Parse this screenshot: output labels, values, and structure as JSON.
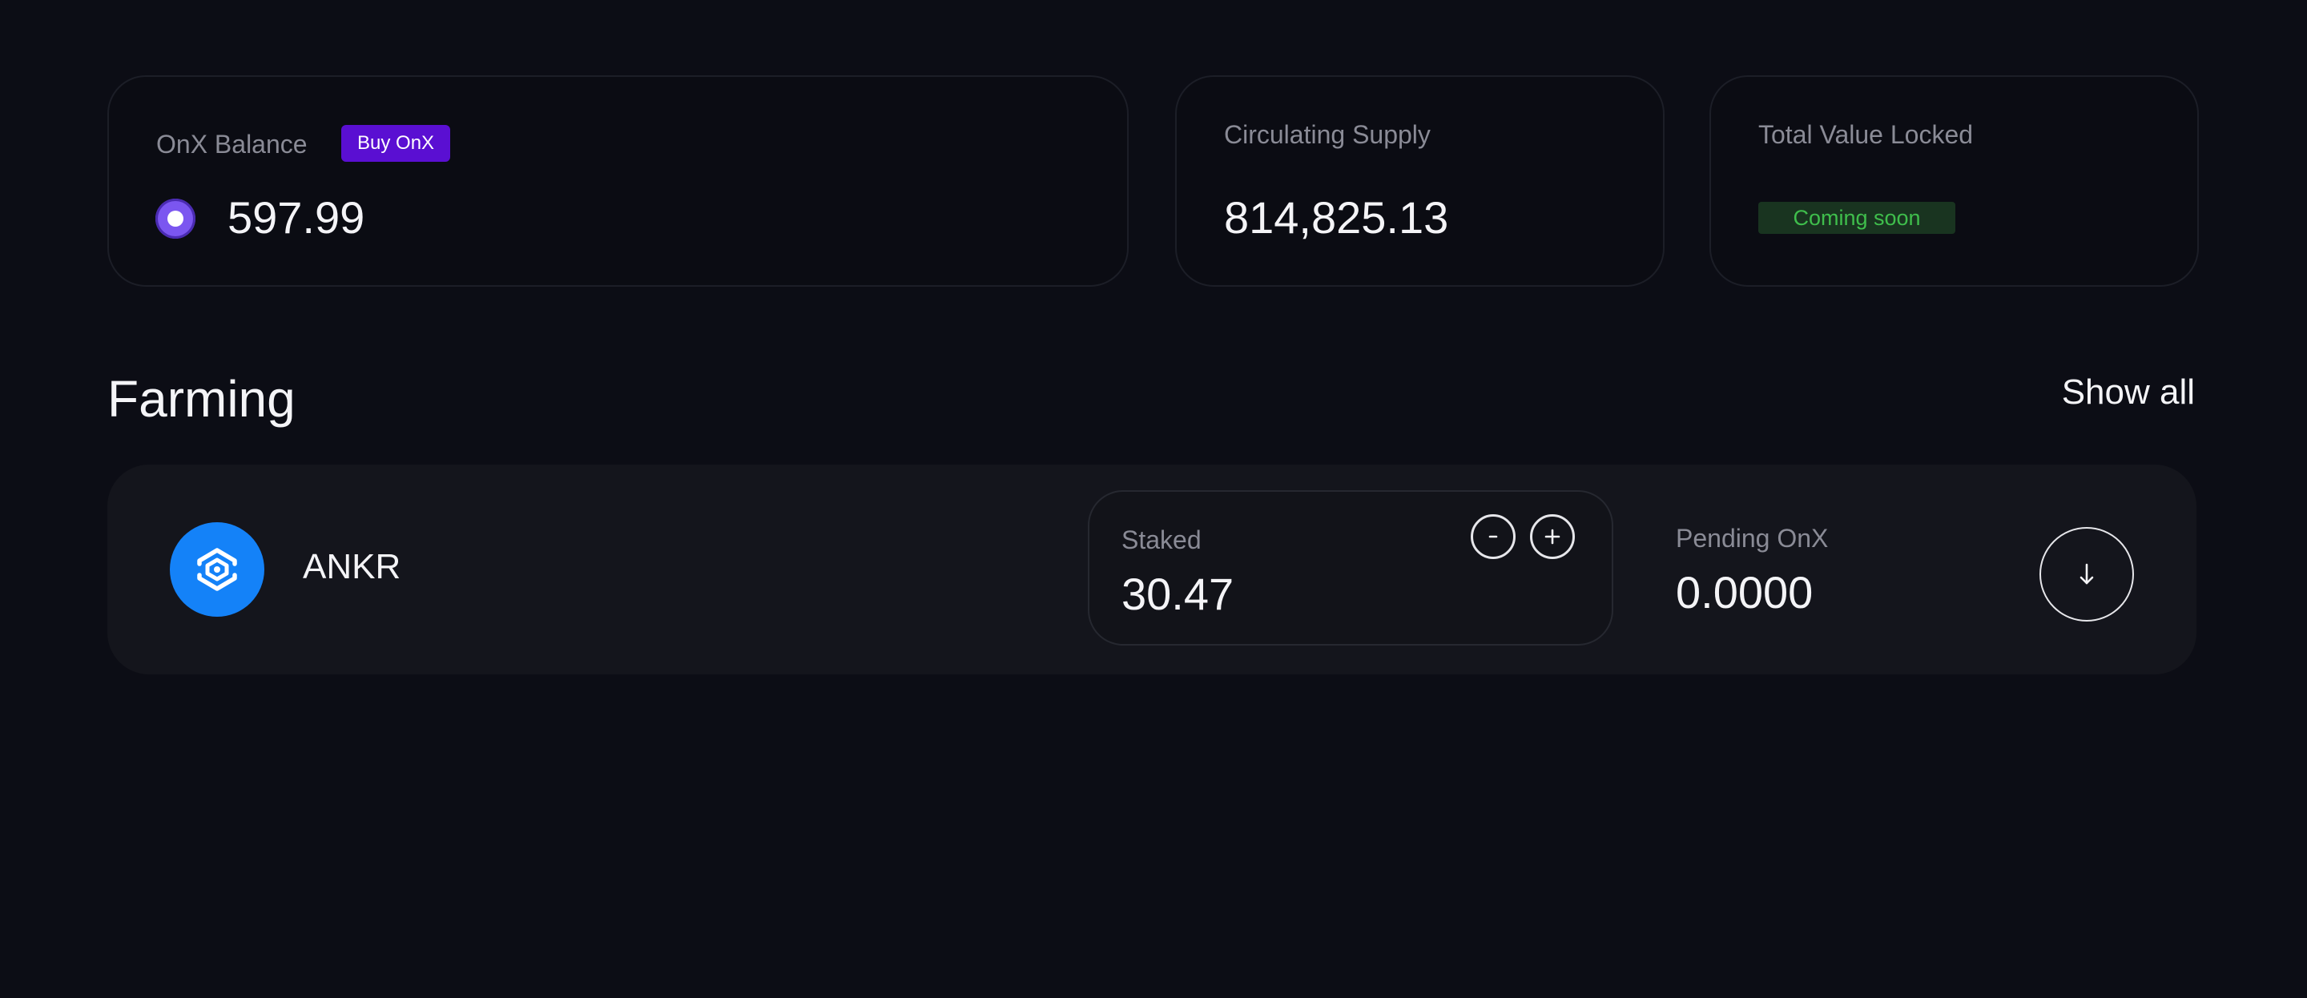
{
  "stats": {
    "balance": {
      "label": "OnX Balance",
      "buy_button": "Buy OnX",
      "value": "597.99",
      "icon": "onx-coin-icon"
    },
    "supply": {
      "label": "Circulating Supply",
      "value": "814,825.13"
    },
    "tvl": {
      "label": "Total Value Locked",
      "badge": "Coming soon"
    }
  },
  "farming": {
    "title": "Farming",
    "show_all": "Show all",
    "pools": [
      {
        "token": "ANKR",
        "icon": "ankr-logo-icon",
        "staked_label": "Staked",
        "staked_value": "30.47",
        "pending_label": "Pending OnX",
        "pending_value": "0.0000"
      }
    ]
  },
  "colors": {
    "background": "#0c0d15",
    "accent_purple": "#5a0fd2",
    "coming_soon_green": "#3fbe4c",
    "ankr_blue": "#1482f8"
  }
}
